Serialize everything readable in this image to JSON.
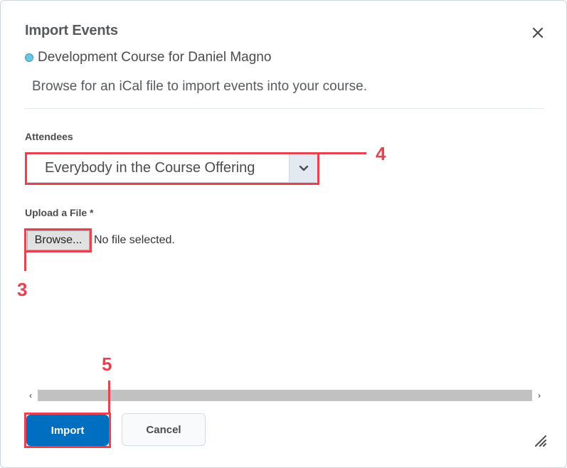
{
  "dialog": {
    "title": "Import Events",
    "close_icon": "close-icon",
    "course": "Development Course for Daniel Magno",
    "course_dot_color": "#6bc6e2",
    "description": "Browse for an iCal file to import events into your course."
  },
  "attendees": {
    "label": "Attendees",
    "selected": "Everybody in the Course Offering",
    "arrow_icon": "chevron-down-icon"
  },
  "upload": {
    "label": "Upload a File *",
    "browse_label": "Browse...",
    "status": "No file selected."
  },
  "scrollbar": {
    "left_icon": "chevron-left-icon",
    "right_icon": "chevron-right-icon",
    "left_glyph": "‹",
    "right_glyph": "›"
  },
  "footer": {
    "import_label": "Import",
    "cancel_label": "Cancel",
    "resize_icon": "resize-handle-icon"
  },
  "annotations": {
    "step_3": "3",
    "step_4": "4",
    "step_5": "5",
    "color": "#e8414f"
  },
  "colors": {
    "primary": "#006fbf",
    "text": "#494c4e",
    "divider": "#e3e9f1"
  }
}
